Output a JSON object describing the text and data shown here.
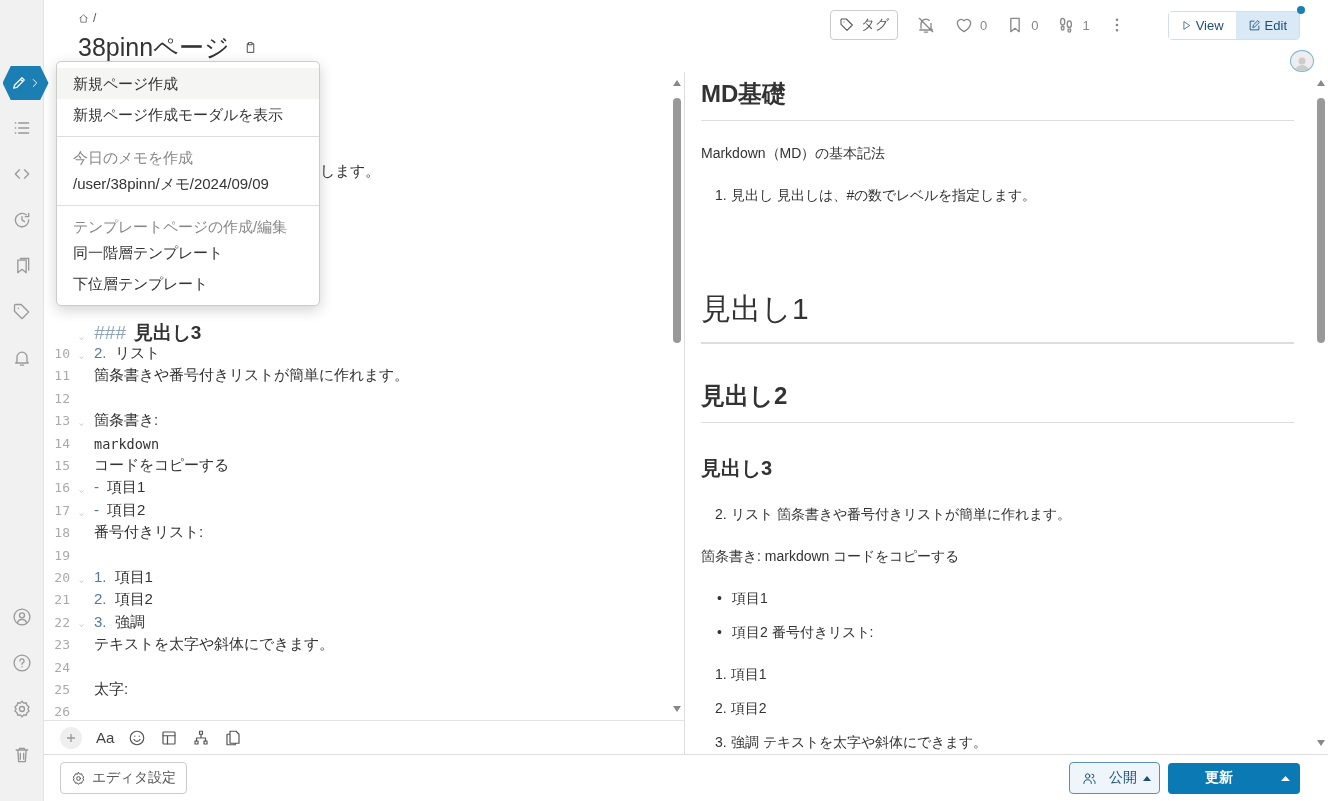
{
  "breadcrumb": "/",
  "page_title": "38pinnページ",
  "toolbar": {
    "tag_label": "タグ",
    "likes": "0",
    "bookmarks": "0",
    "footprints": "1",
    "notification_dot": true,
    "view_modes": [
      {
        "label": "View",
        "kind": "view",
        "selected": false
      },
      {
        "label": "Edit",
        "kind": "edit",
        "selected": true
      }
    ]
  },
  "sidebar": {
    "top": [
      {
        "kind": "list"
      },
      {
        "kind": "code"
      },
      {
        "kind": "history"
      },
      {
        "kind": "bookmarks"
      },
      {
        "kind": "tag"
      },
      {
        "kind": "bell"
      }
    ],
    "bottom": [
      {
        "kind": "user"
      },
      {
        "kind": "help"
      },
      {
        "kind": "gear"
      },
      {
        "kind": "trash"
      }
    ]
  },
  "menu": [
    {
      "kind": "item",
      "label": "新規ページ作成",
      "selected": true
    },
    {
      "kind": "item",
      "label": "新規ページ作成モーダルを表示",
      "selected": false
    },
    {
      "kind": "divider"
    },
    {
      "kind": "header",
      "label": "今日のメモを作成"
    },
    {
      "kind": "item",
      "label": "/user/38pinn/メモ/2024/09/09",
      "selected": false
    },
    {
      "kind": "divider"
    },
    {
      "kind": "header",
      "label": "テンプレートページの作成/編集"
    },
    {
      "kind": "item",
      "label": "同一階層テンプレート",
      "selected": false
    },
    {
      "kind": "item",
      "label": "下位層テンプレート",
      "selected": false
    }
  ],
  "editor": {
    "fragment": "します。",
    "lines": [
      {
        "kind": "heading",
        "marker": "###",
        "text": "見出し3",
        "foldable": true
      },
      {
        "number": "10",
        "kind": "text",
        "marker": "2.",
        "text": "リスト",
        "foldable": true
      },
      {
        "number": "11",
        "kind": "text",
        "text": "箇条書きや番号付きリストが簡単に作れます。",
        "foldable": false
      },
      {
        "number": "12",
        "kind": "text",
        "foldable": false
      },
      {
        "number": "13",
        "kind": "text",
        "text": "箇条書き:",
        "foldable": true
      },
      {
        "number": "14",
        "kind": "code",
        "text": "markdown",
        "foldable": false
      },
      {
        "number": "15",
        "kind": "text",
        "text": "コードをコピーする",
        "foldable": false
      },
      {
        "number": "16",
        "kind": "text",
        "marker": "-",
        "text": "項目1",
        "foldable": true
      },
      {
        "number": "17",
        "kind": "text",
        "marker": "-",
        "text": "項目2",
        "foldable": true
      },
      {
        "number": "18",
        "kind": "text",
        "text": "番号付きリスト:",
        "foldable": false
      },
      {
        "number": "19",
        "kind": "text",
        "foldable": false
      },
      {
        "number": "20",
        "kind": "text",
        "marker": "1.",
        "text": "項目1",
        "foldable": true
      },
      {
        "number": "21",
        "kind": "text",
        "marker": "2.",
        "text": "項目2",
        "foldable": false
      },
      {
        "number": "22",
        "kind": "text",
        "marker": "3.",
        "text": "強調",
        "foldable": true
      },
      {
        "number": "23",
        "kind": "text",
        "text": "テキストを太字や斜体にできます。",
        "foldable": false
      },
      {
        "number": "24",
        "kind": "text",
        "foldable": false
      },
      {
        "number": "25",
        "kind": "text",
        "text": "太字:",
        "foldable": false
      },
      {
        "number": "26",
        "kind": "text",
        "foldable": false
      }
    ],
    "format_button": "Aa"
  },
  "preview": [
    {
      "kind": "title",
      "text": "MD基礎"
    },
    {
      "kind": "paragraph",
      "text": "Markdown（MD）の基本記法"
    },
    {
      "kind": "ordered",
      "marker": "1.",
      "text": "見出し 見出しは、#の数でレベルを指定します。"
    },
    {
      "kind": "heading1",
      "text": "見出し1"
    },
    {
      "kind": "heading2",
      "text": "見出し2"
    },
    {
      "kind": "heading3",
      "text": "見出し3"
    },
    {
      "kind": "ordered",
      "marker": "2.",
      "text": "リスト 箇条書きや番号付きリストが簡単に作れます。"
    },
    {
      "kind": "paragraph",
      "text": "箇条書き: markdown コードをコピーする"
    },
    {
      "kind": "bullet",
      "marker": "•",
      "text": "項目1"
    },
    {
      "kind": "bullet",
      "marker": "•",
      "text": "項目2 番号付きリスト:"
    },
    {
      "kind": "ordered",
      "marker": "1.",
      "text": "項目1"
    },
    {
      "kind": "ordered",
      "marker": "2.",
      "text": "項目2"
    },
    {
      "kind": "ordered",
      "marker": "3.",
      "text": "強調 テキストを太字や斜体にできます。"
    }
  ],
  "footer": {
    "editor_settings": "エディタ設定",
    "visibility": "公開",
    "update": "更新"
  }
}
